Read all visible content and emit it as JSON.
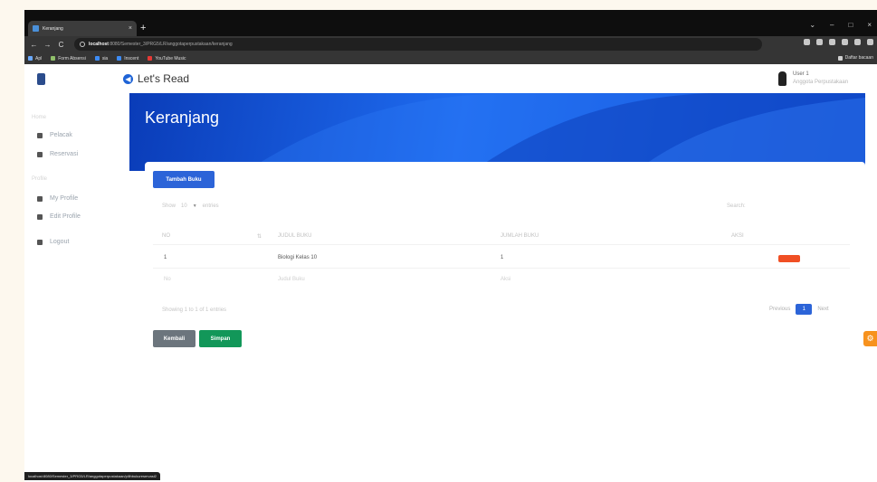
{
  "browser": {
    "tab_title": "Keranjang",
    "tab_close": "×",
    "new_tab": "+",
    "window_controls": [
      "⌄",
      "–",
      "□",
      "×"
    ],
    "nav": [
      "←",
      "→",
      "C"
    ],
    "url_host": "localhost",
    "url_path": ":8080/Semester_3/PRG5/LR/anggotaperpustakaan/keranjang",
    "bookmarks": [
      {
        "label": "Apl",
        "color": "#6aa9ff"
      },
      {
        "label": "Form Absensi",
        "color": "#8fbf6a"
      },
      {
        "label": "sia",
        "color": "#3d8cf5"
      },
      {
        "label": "Inscent",
        "color": "#3d8cf5"
      },
      {
        "label": "YouTube Music",
        "color": "#e53935"
      }
    ],
    "reading_list": "Daftar bacaan",
    "status_url": "localhost:8080/Semester_3/PRG5/LR/anggotaperpustakaan/pilihbukureservasi2"
  },
  "sidebar": {
    "sections": [
      {
        "label": "Home",
        "items": [
          {
            "label": "Pelacak",
            "icon": "search-icon"
          },
          {
            "label": "Reservasi",
            "icon": "file-icon"
          }
        ]
      },
      {
        "label": "Profile",
        "items": [
          {
            "label": "My Profile",
            "icon": "user-icon"
          },
          {
            "label": "Edit Profile",
            "icon": "user-edit-icon"
          }
        ]
      }
    ],
    "logout": "Logout"
  },
  "header": {
    "app_title": "Let's Read",
    "back_icon": "◀",
    "user_name": "User 1",
    "user_role": "Anggota Perpustakaan"
  },
  "page": {
    "title": "Keranjang",
    "add_button": "Tambah Buku",
    "show_label": "Show",
    "entries_value": "10",
    "entries_label": "entries",
    "search_label": "Search:",
    "columns": [
      "NO",
      "JUDUL BUKU",
      "JUMLAH BUKU",
      "AKSI"
    ],
    "rows": [
      {
        "no": "1",
        "judul": "Biologi Kelas 10",
        "jumlah": "1"
      }
    ],
    "footer_columns": [
      "No",
      "Judul Buku",
      "Aksi"
    ],
    "info": "Showing 1 to 1 of 1 entries",
    "pagination": {
      "previous": "Previous",
      "current": "1",
      "next": "Next"
    },
    "back_button": "Kembali",
    "save_button": "Simpan"
  },
  "colors": {
    "primary": "#2c64d8",
    "success": "#129759",
    "danger": "#f04f24",
    "secondary": "#6c757d",
    "float": "#f7921e"
  }
}
